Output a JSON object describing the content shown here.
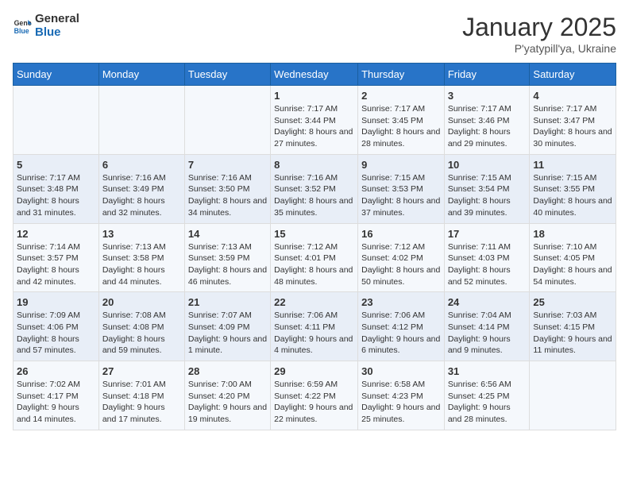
{
  "header": {
    "logo_general": "General",
    "logo_blue": "Blue",
    "title": "January 2025",
    "subtitle": "P'yatypill'ya, Ukraine"
  },
  "weekdays": [
    "Sunday",
    "Monday",
    "Tuesday",
    "Wednesday",
    "Thursday",
    "Friday",
    "Saturday"
  ],
  "weeks": [
    [
      {
        "day": "",
        "info": ""
      },
      {
        "day": "",
        "info": ""
      },
      {
        "day": "",
        "info": ""
      },
      {
        "day": "1",
        "info": "Sunrise: 7:17 AM\nSunset: 3:44 PM\nDaylight: 8 hours and 27 minutes."
      },
      {
        "day": "2",
        "info": "Sunrise: 7:17 AM\nSunset: 3:45 PM\nDaylight: 8 hours and 28 minutes."
      },
      {
        "day": "3",
        "info": "Sunrise: 7:17 AM\nSunset: 3:46 PM\nDaylight: 8 hours and 29 minutes."
      },
      {
        "day": "4",
        "info": "Sunrise: 7:17 AM\nSunset: 3:47 PM\nDaylight: 8 hours and 30 minutes."
      }
    ],
    [
      {
        "day": "5",
        "info": "Sunrise: 7:17 AM\nSunset: 3:48 PM\nDaylight: 8 hours and 31 minutes."
      },
      {
        "day": "6",
        "info": "Sunrise: 7:16 AM\nSunset: 3:49 PM\nDaylight: 8 hours and 32 minutes."
      },
      {
        "day": "7",
        "info": "Sunrise: 7:16 AM\nSunset: 3:50 PM\nDaylight: 8 hours and 34 minutes."
      },
      {
        "day": "8",
        "info": "Sunrise: 7:16 AM\nSunset: 3:52 PM\nDaylight: 8 hours and 35 minutes."
      },
      {
        "day": "9",
        "info": "Sunrise: 7:15 AM\nSunset: 3:53 PM\nDaylight: 8 hours and 37 minutes."
      },
      {
        "day": "10",
        "info": "Sunrise: 7:15 AM\nSunset: 3:54 PM\nDaylight: 8 hours and 39 minutes."
      },
      {
        "day": "11",
        "info": "Sunrise: 7:15 AM\nSunset: 3:55 PM\nDaylight: 8 hours and 40 minutes."
      }
    ],
    [
      {
        "day": "12",
        "info": "Sunrise: 7:14 AM\nSunset: 3:57 PM\nDaylight: 8 hours and 42 minutes."
      },
      {
        "day": "13",
        "info": "Sunrise: 7:13 AM\nSunset: 3:58 PM\nDaylight: 8 hours and 44 minutes."
      },
      {
        "day": "14",
        "info": "Sunrise: 7:13 AM\nSunset: 3:59 PM\nDaylight: 8 hours and 46 minutes."
      },
      {
        "day": "15",
        "info": "Sunrise: 7:12 AM\nSunset: 4:01 PM\nDaylight: 8 hours and 48 minutes."
      },
      {
        "day": "16",
        "info": "Sunrise: 7:12 AM\nSunset: 4:02 PM\nDaylight: 8 hours and 50 minutes."
      },
      {
        "day": "17",
        "info": "Sunrise: 7:11 AM\nSunset: 4:03 PM\nDaylight: 8 hours and 52 minutes."
      },
      {
        "day": "18",
        "info": "Sunrise: 7:10 AM\nSunset: 4:05 PM\nDaylight: 8 hours and 54 minutes."
      }
    ],
    [
      {
        "day": "19",
        "info": "Sunrise: 7:09 AM\nSunset: 4:06 PM\nDaylight: 8 hours and 57 minutes."
      },
      {
        "day": "20",
        "info": "Sunrise: 7:08 AM\nSunset: 4:08 PM\nDaylight: 8 hours and 59 minutes."
      },
      {
        "day": "21",
        "info": "Sunrise: 7:07 AM\nSunset: 4:09 PM\nDaylight: 9 hours and 1 minute."
      },
      {
        "day": "22",
        "info": "Sunrise: 7:06 AM\nSunset: 4:11 PM\nDaylight: 9 hours and 4 minutes."
      },
      {
        "day": "23",
        "info": "Sunrise: 7:06 AM\nSunset: 4:12 PM\nDaylight: 9 hours and 6 minutes."
      },
      {
        "day": "24",
        "info": "Sunrise: 7:04 AM\nSunset: 4:14 PM\nDaylight: 9 hours and 9 minutes."
      },
      {
        "day": "25",
        "info": "Sunrise: 7:03 AM\nSunset: 4:15 PM\nDaylight: 9 hours and 11 minutes."
      }
    ],
    [
      {
        "day": "26",
        "info": "Sunrise: 7:02 AM\nSunset: 4:17 PM\nDaylight: 9 hours and 14 minutes."
      },
      {
        "day": "27",
        "info": "Sunrise: 7:01 AM\nSunset: 4:18 PM\nDaylight: 9 hours and 17 minutes."
      },
      {
        "day": "28",
        "info": "Sunrise: 7:00 AM\nSunset: 4:20 PM\nDaylight: 9 hours and 19 minutes."
      },
      {
        "day": "29",
        "info": "Sunrise: 6:59 AM\nSunset: 4:22 PM\nDaylight: 9 hours and 22 minutes."
      },
      {
        "day": "30",
        "info": "Sunrise: 6:58 AM\nSunset: 4:23 PM\nDaylight: 9 hours and 25 minutes."
      },
      {
        "day": "31",
        "info": "Sunrise: 6:56 AM\nSunset: 4:25 PM\nDaylight: 9 hours and 28 minutes."
      },
      {
        "day": "",
        "info": ""
      }
    ]
  ]
}
